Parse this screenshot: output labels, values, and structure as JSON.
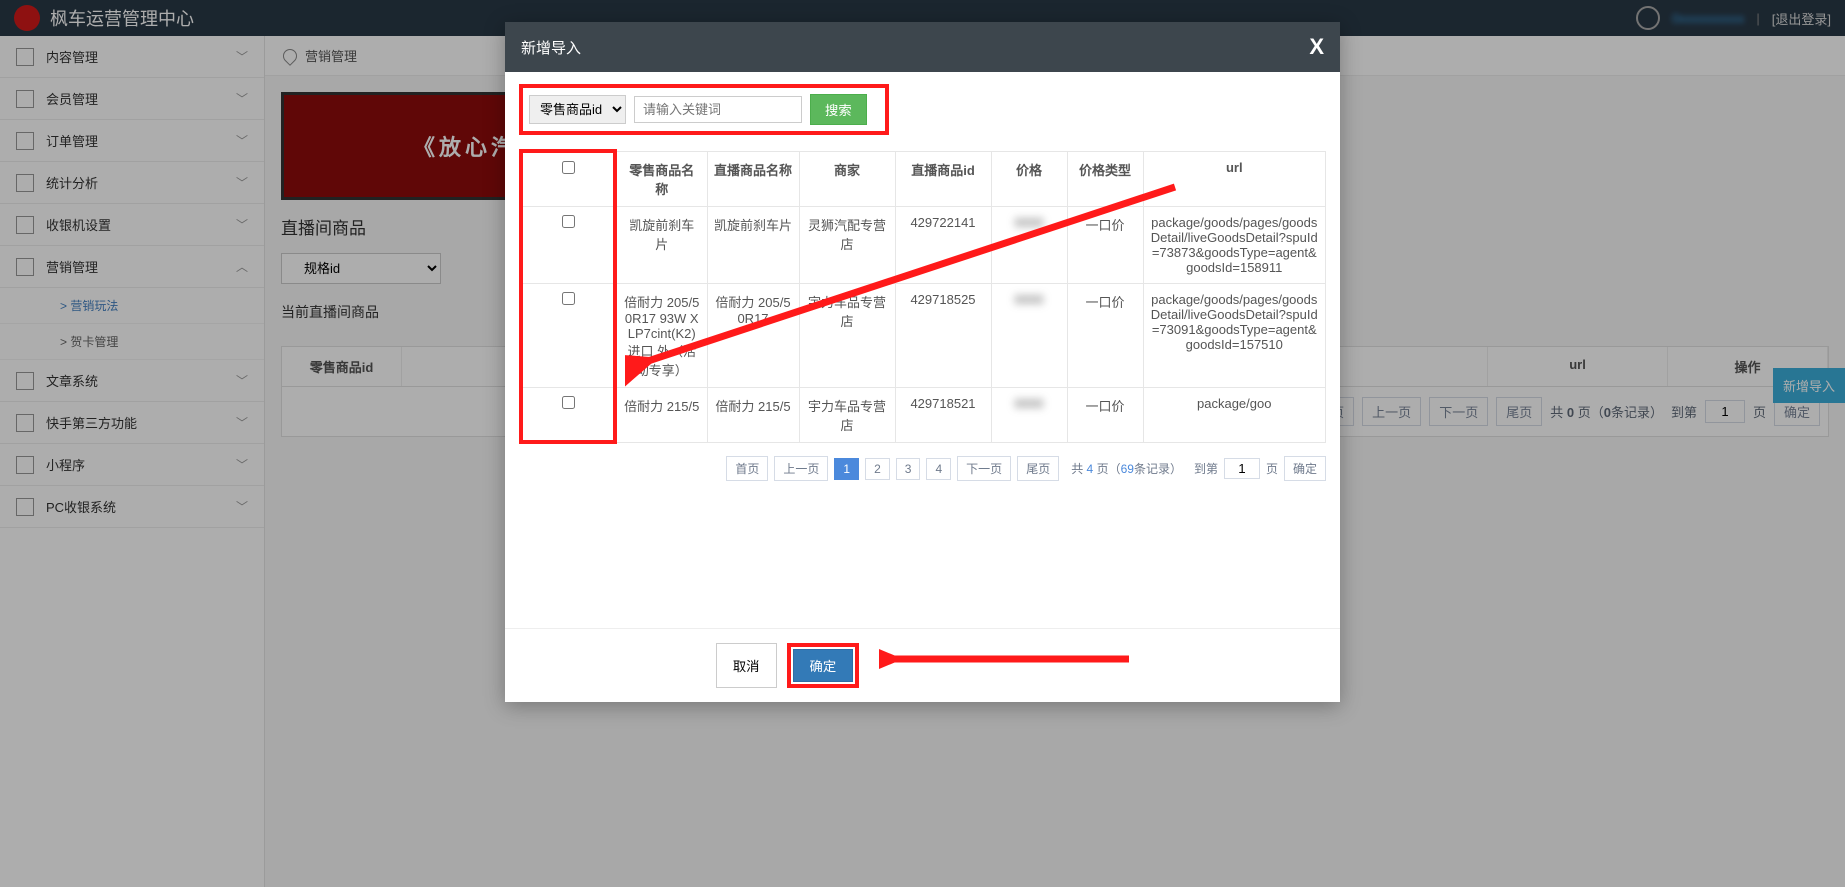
{
  "header": {
    "title": "枫车运营管理中心",
    "phone": "0xxxxxxxxxx",
    "logout": "[退出登录]"
  },
  "sidebar": {
    "items": [
      {
        "label": "内容管理"
      },
      {
        "label": "会员管理"
      },
      {
        "label": "订单管理"
      },
      {
        "label": "统计分析"
      },
      {
        "label": "收银机设置"
      },
      {
        "label": "营销管理"
      },
      {
        "label": "文章系统"
      },
      {
        "label": "快手第三方功能"
      },
      {
        "label": "小程序"
      },
      {
        "label": "PC收银系统"
      }
    ],
    "subitems": [
      {
        "label": "> 营销玩法",
        "active": true
      },
      {
        "label": "> 贺卡管理",
        "active": false
      }
    ]
  },
  "breadcrumb": "营销管理",
  "banner_text": "《放心汽配》",
  "section_title": "直播间商品",
  "spec_select": "规格id",
  "cur_live_goods_label": "当前直播间商品",
  "new_import_btn": "新增导入",
  "bg_table": {
    "headers": [
      "零售商品id",
      "url",
      "操作"
    ],
    "pager": {
      "first": "首页",
      "prev": "上一页",
      "next": "下一页",
      "last": "尾页",
      "total_text_a": "共 ",
      "total_pages": "0",
      "total_text_b": " 页（",
      "total_records": "0",
      "total_text_c": "条记录）",
      "goto": "到第",
      "page_val": "1",
      "page_unit": "页",
      "confirm": "确定"
    }
  },
  "dialog": {
    "title": "新增导入",
    "search": {
      "select": "零售商品id",
      "placeholder": "请输入关键词",
      "button": "搜索"
    },
    "columns": [
      "",
      "零售商品名称",
      "直播商品名称",
      "商家",
      "直播商品id",
      "价格",
      "价格类型",
      "url"
    ],
    "rows": [
      {
        "retail_name": "凯旋前刹车片",
        "live_name": "凯旋前刹车片",
        "merchant": "灵狮汽配专营店",
        "live_id": "429722141",
        "price": "",
        "price_type": "一口价",
        "url": "package/goods/pages/goodsDetail/liveGoodsDetail?spuId=73873&goodsType=agent&goodsId=158911"
      },
      {
        "retail_name": "倍耐力 205/50R17 93W XLP7cint(K2) 进口 外（活动专享）",
        "live_name": "倍耐力 205/50R17",
        "merchant": "宇力车品专营店",
        "live_id": "429718525",
        "price": "",
        "price_type": "一口价",
        "url": "package/goods/pages/goodsDetail/liveGoodsDetail?spuId=73091&goodsType=agent&goodsId=157510"
      },
      {
        "retail_name": "倍耐力 215/5",
        "live_name": "倍耐力 215/5",
        "merchant": "宇力车品专营店",
        "live_id": "429718521",
        "price": "",
        "price_type": "一口价",
        "url": "package/goo"
      }
    ],
    "pager": {
      "first": "首页",
      "prev": "上一页",
      "pages": [
        "1",
        "2",
        "3",
        "4"
      ],
      "next": "下一页",
      "last": "尾页",
      "info_a": "共 ",
      "info_pages": "4",
      "info_b": " 页（",
      "info_rec": "69",
      "info_c": "条记录）",
      "goto": "到第",
      "page_val": "1",
      "page_unit": "页",
      "confirm": "确定"
    },
    "footer": {
      "cancel": "取消",
      "ok": "确定"
    }
  }
}
